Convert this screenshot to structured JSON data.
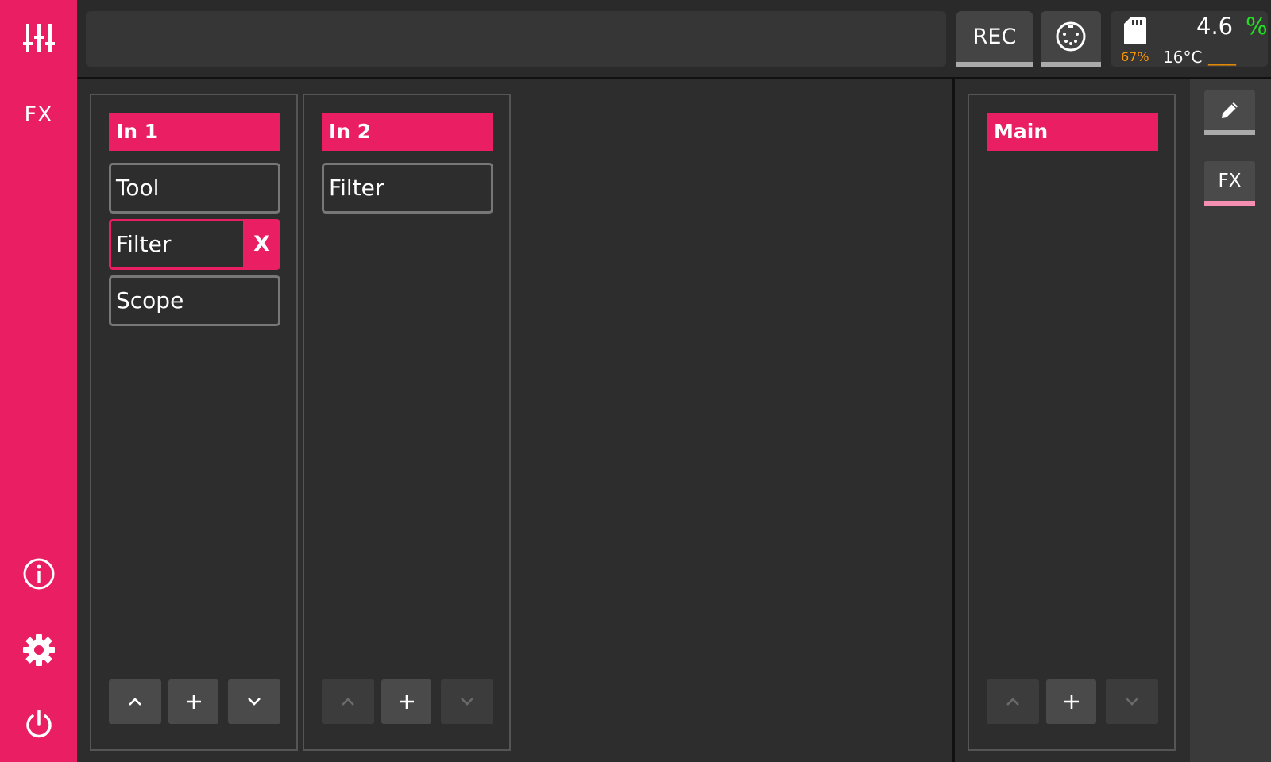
{
  "sidebar": {
    "mixer_icon": "sliders-icon",
    "fx_label": "FX",
    "info_icon": "info-icon",
    "settings_icon": "gear-icon",
    "power_icon": "power-icon"
  },
  "topbar": {
    "status_text": "",
    "rec_label": "REC",
    "midi_icon": "midi-din-icon",
    "sd_icon": "sd-card-icon",
    "sd_percent": "67%",
    "cpu_value": "4.6",
    "cpu_unit": "%",
    "temperature": "16°C",
    "temp_bars": "____"
  },
  "channels": [
    {
      "name": "In 1",
      "slots": [
        "Tool",
        "Filter",
        "Scope"
      ],
      "selected_slot": "Filter",
      "remove_label": "X",
      "up_enabled": true,
      "down_enabled": true
    },
    {
      "name": "In 2",
      "slots": [
        "Filter"
      ],
      "up_enabled": false,
      "down_enabled": false
    }
  ],
  "main": {
    "name": "Main",
    "up_enabled": false,
    "down_enabled": false
  },
  "rail": {
    "edit_icon": "pencil-icon",
    "fx_label": "FX"
  },
  "colors": {
    "accent": "#e91e63",
    "background": "#2d2d2d",
    "cpu_ok": "#22e022",
    "warn": "#ff9800"
  }
}
